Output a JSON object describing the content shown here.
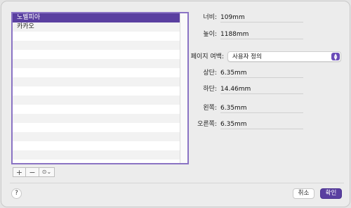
{
  "list": {
    "items": [
      {
        "label": "노벨피아",
        "selected": true
      },
      {
        "label": "카카오",
        "selected": false
      }
    ]
  },
  "toolbar": {
    "add_label": "+",
    "remove_label": "−",
    "action_label": "⊙⌄"
  },
  "form": {
    "width_label": "너비:",
    "width_value": "109mm",
    "height_label": "높이:",
    "height_value": "1188mm",
    "margins_label": "페이지 여백:",
    "margins_value": "사용자 정의",
    "top_label": "상단:",
    "top_value": "6.35mm",
    "bottom_label": "하단:",
    "bottom_value": "14.46mm",
    "left_label": "왼쪽:",
    "left_value": "6.35mm",
    "right_label": "오른쪽:",
    "right_value": "6.35mm"
  },
  "footer": {
    "help_label": "?",
    "cancel_label": "취소",
    "ok_label": "확인"
  },
  "colors": {
    "accent": "#5a3fa0",
    "list_border": "#8a73c4"
  }
}
